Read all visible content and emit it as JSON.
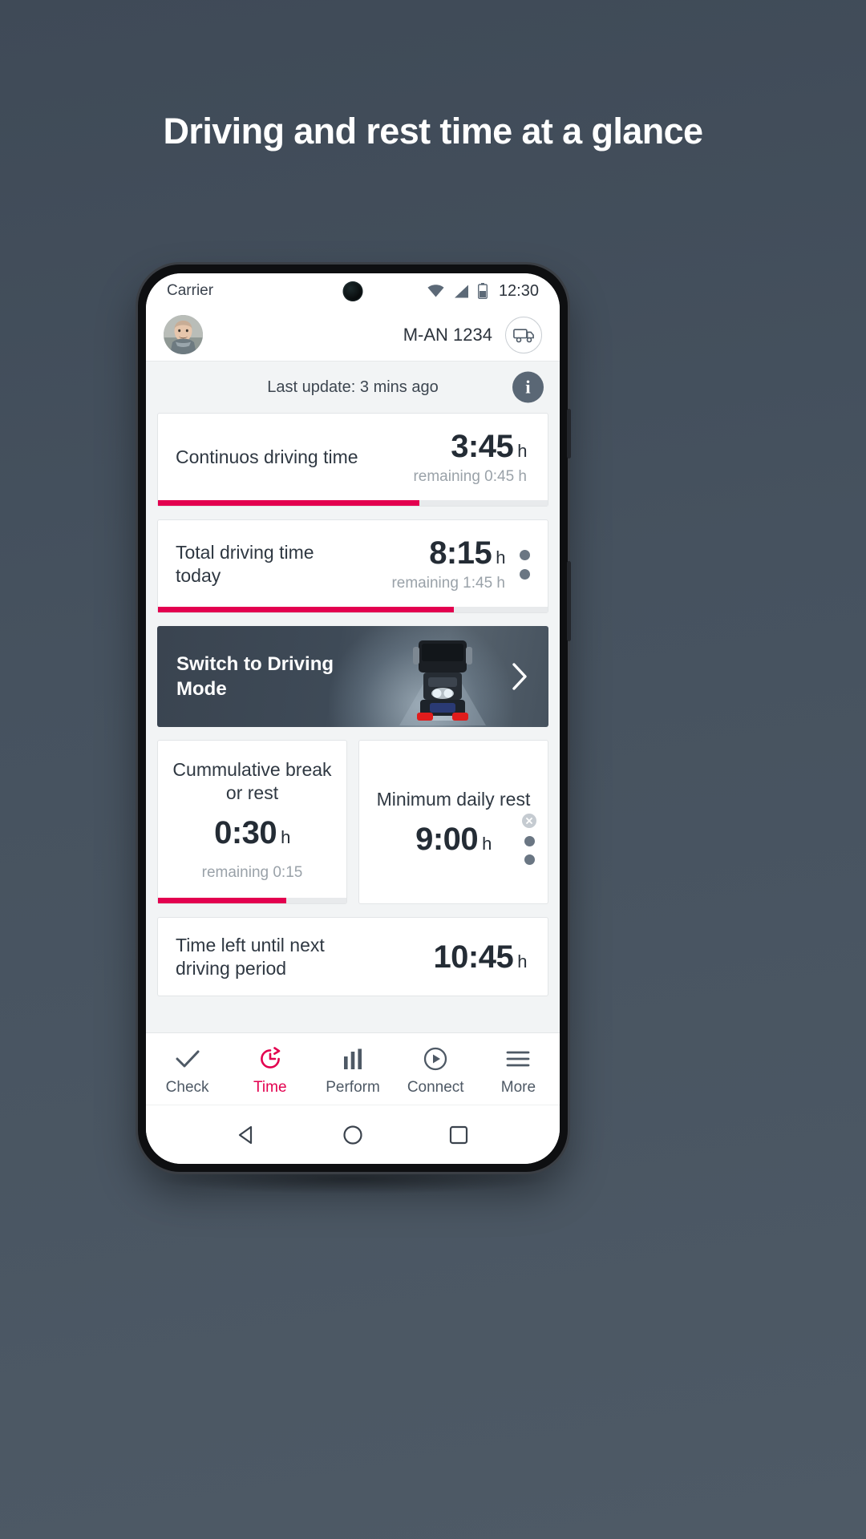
{
  "promo": {
    "heading": "Driving and rest time at a glance"
  },
  "statusbar": {
    "carrier": "Carrier",
    "time": "12:30",
    "icons": [
      "wifi-icon",
      "signal-icon",
      "battery-icon"
    ]
  },
  "header": {
    "avatar": "user-avatar",
    "vehicle_id": "M-AN 1234",
    "truck_icon": "truck-icon"
  },
  "update": {
    "text": "Last update: 3 mins ago",
    "info_label": "i"
  },
  "cards": [
    {
      "label": "Continuos driving time",
      "value": "3:45",
      "unit": "h",
      "sub": "remaining 0:45 h",
      "progress_percent": 67,
      "progress_color": "#e3004f"
    },
    {
      "label": "Total driving time today",
      "value": "8:15",
      "unit": "h",
      "sub": "remaining 1:45 h",
      "progress_percent": 76,
      "progress_color": "#e3004f"
    }
  ],
  "banner": {
    "label": "Switch to Driving Mode",
    "chevron": "chevron-right-icon"
  },
  "duo": [
    {
      "label": "Cummulative break or rest",
      "value": "0:30",
      "unit": "h",
      "sub": "remaining 0:15",
      "progress_percent": 68,
      "progress_color": "#e3004f"
    },
    {
      "label": "Minimum daily rest",
      "value": "9:00",
      "unit": "h",
      "sub": ""
    }
  ],
  "final_card": {
    "label": "Time left until next driving period",
    "value": "10:45",
    "unit": "h"
  },
  "bottom_nav": [
    {
      "label": "Check",
      "icon": "check-icon",
      "active": false
    },
    {
      "label": "Time",
      "icon": "clock-history-icon",
      "active": true
    },
    {
      "label": "Perform",
      "icon": "bar-chart-icon",
      "active": false
    },
    {
      "label": "Connect",
      "icon": "play-circle-icon",
      "active": false
    },
    {
      "label": "More",
      "icon": "hamburger-icon",
      "active": false
    }
  ],
  "system_nav": [
    "back-triangle-icon",
    "home-circle-icon",
    "recents-square-icon"
  ],
  "colors": {
    "accent": "#e3004f",
    "page_bg": "#434f5c",
    "card_bg": "#ffffff",
    "content_bg": "#f2f4f5",
    "text_dark": "#242c35",
    "text_muted": "#9aa2a9"
  }
}
